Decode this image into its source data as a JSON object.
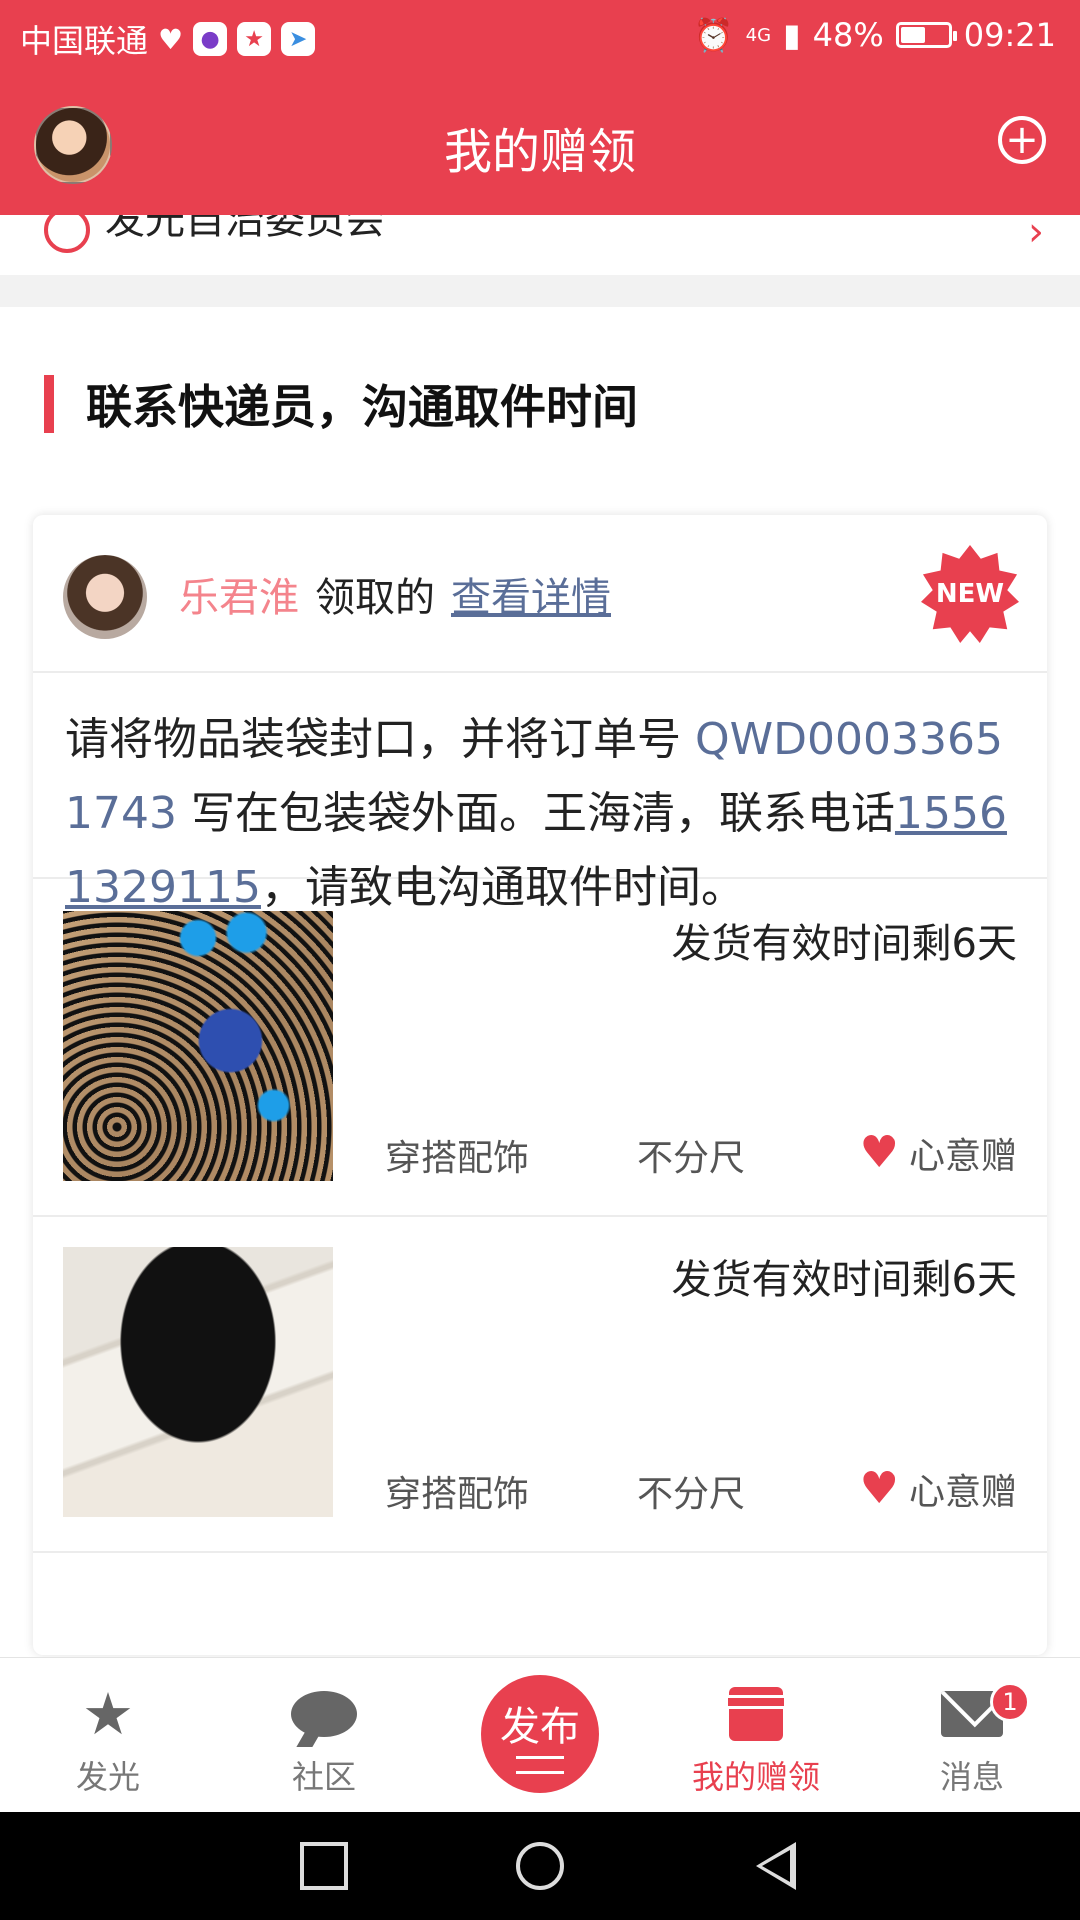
{
  "status_bar": {
    "carrier": "中国联通",
    "network": "4G",
    "battery": "48%",
    "battery_level": 0.48,
    "time": "09:21"
  },
  "header": {
    "title": "我的赠领"
  },
  "previous_row": {
    "label": "发光自治委员会"
  },
  "section": {
    "title": "联系快递员，沟通取件时间"
  },
  "card": {
    "user_name": "乐君淮",
    "action_text": "领取的",
    "detail_link": "查看详情",
    "badge": "NEW",
    "notice": {
      "part1": "请将物品装袋封口，并将订单号 ",
      "order_no": "QWD00033651743",
      "part2": " 写在包装袋外面。王海清，联系电话",
      "phone": "15561329115",
      "part3": "，请致电沟通取件时间。"
    },
    "items": [
      {
        "deadline": "发货有效时间剩6天",
        "category": "穿搭配饰",
        "size": "不分尺",
        "gift_type": "心意赠"
      },
      {
        "deadline": "发货有效时间剩6天",
        "category": "穿搭配饰",
        "size": "不分尺",
        "gift_type": "心意赠"
      }
    ]
  },
  "tabbar": {
    "tabs": [
      {
        "label": "发光",
        "icon": "star-icon"
      },
      {
        "label": "社区",
        "icon": "chat-bubble-icon"
      },
      {
        "label": "发布",
        "icon": "publish-icon"
      },
      {
        "label": "我的赠领",
        "icon": "gift-box-icon",
        "active": true
      },
      {
        "label": "消息",
        "icon": "mail-icon",
        "badge": "1"
      }
    ]
  },
  "colors": {
    "accent": "#e8404f",
    "link": "#5a6e98",
    "username": "#f4848c"
  }
}
